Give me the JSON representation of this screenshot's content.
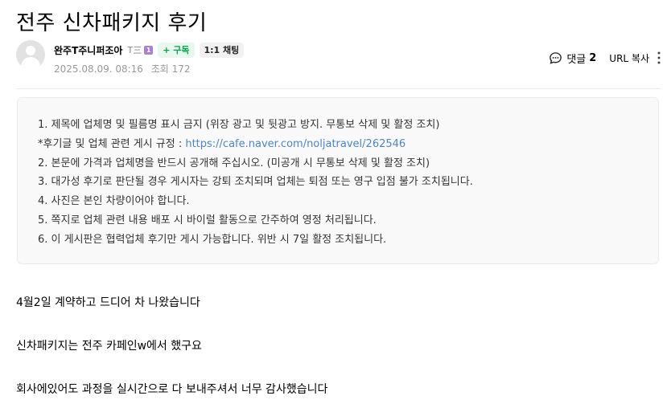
{
  "post": {
    "title": "전주 신차패키지 후기",
    "author": {
      "name": "완주T주니퍼조아",
      "grade_text": "T三",
      "grade_badge": "1"
    },
    "subscribe_label": "+ 구독",
    "chat_label": "1:1 채팅",
    "date": "2025.08.09. 08:16",
    "views": "조회 172",
    "comment_label": "댓글",
    "comment_count": "2",
    "url_copy_label": "URL 복사"
  },
  "notice": {
    "items": [
      "1. 제목에 업체명 및 필름명 표시 금지 (위장 광고 및 뒷광고 방지. 무통보 삭제 및 활정 조치)",
      "*후기글 및 업체 관련 게시 규정 : ",
      "2. 본문에 가격과 업체명을 반드시 공개해 주십시오. (미공개 시 무통보 삭제 및 활정 조치)",
      "3. 대가성 후기로 판단될 경우 게시자는 강퇴 조치되며 업체는 퇴점 또는 영구 입점 불가 조치됩니다.",
      "4. 사진은 본인 차량이어야 합니다.",
      "5. 쪽지로 업체 관련 내용 배포 시 바이럴 활동으로 간주하여 영정 처리됩니다.",
      "6. 이 게시판은 협력업체 후기만 게시 가능합니다. 위반 시 7일 활정 조치됩니다."
    ],
    "link": "https://cafe.naver.com/noljatravel/262546"
  },
  "content": {
    "paragraphs": [
      "4월2일 계약하고 드디어 차 나왔습니다",
      "신차패키지는 전주 카페인w에서 했구요",
      "회사에있어도 과정을 실시간으로 다 보내주셔서 너무 감사했습니다"
    ]
  },
  "colors": {
    "link": "#4a86c8",
    "subscribe_green": "#03a94d",
    "grade_purple": "#a97fd4"
  },
  "icons": [
    "comment-icon",
    "more-vertical-icon",
    "avatar-icon"
  ]
}
